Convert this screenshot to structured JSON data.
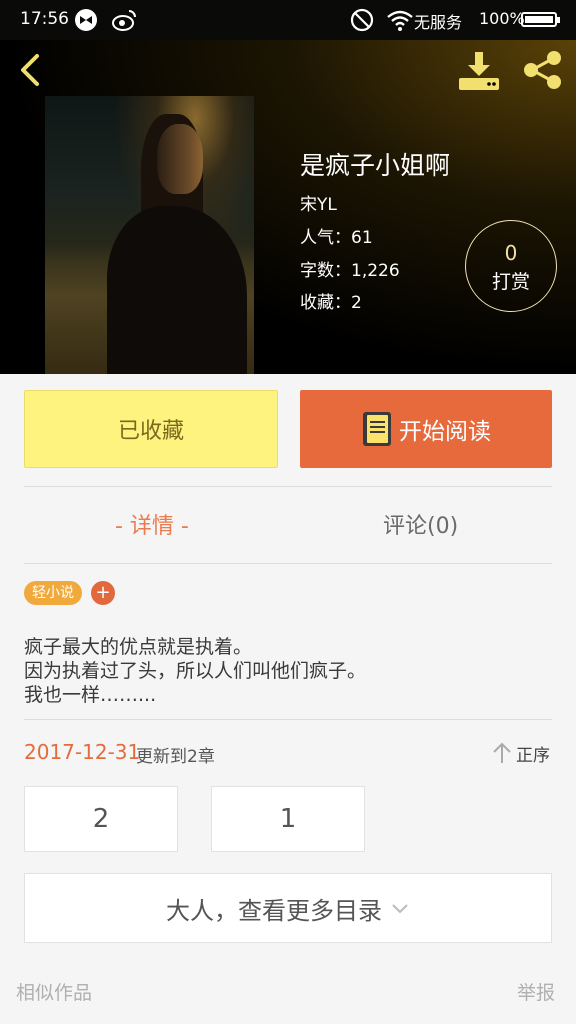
{
  "status_bar": {
    "time": "17:56",
    "network": "无服务",
    "battery_percent": "100%",
    "battery_level": 1.0
  },
  "header": {
    "back_icon": "chevron-left-icon",
    "download_icon": "download-icon",
    "share_icon": "share-icon"
  },
  "book": {
    "title": "是疯子小姐啊",
    "author": "宋YL",
    "popularity": "人气：61",
    "word_count": "字数：1,226",
    "favorites": "收藏：2",
    "tip_count": "0",
    "tip_label": "打赏"
  },
  "actions": {
    "collected_label": "已收藏",
    "read_label": "开始阅读"
  },
  "tabs": {
    "detail_label": "- 详情 -",
    "comment_label": "评论(0)"
  },
  "tags": {
    "tag1": "轻小说",
    "add": "+"
  },
  "description": {
    "line1": "疯子最大的优点就是执着。",
    "line2": "因为执着过了头，所以人们叫他们疯子。",
    "line3": "我也一样……..."
  },
  "update": {
    "date": "2017-12-31",
    "text": "更新到2章",
    "sort_label": "正序"
  },
  "chapters": [
    "2",
    "1"
  ],
  "more_label": "大人，查看更多目录",
  "footer": {
    "similar": "相似作品",
    "report": "举报"
  },
  "colors": {
    "accent_orange": "#e76a3d",
    "collected_yellow": "#fdf37e",
    "tag_orange": "#f2a93b"
  }
}
